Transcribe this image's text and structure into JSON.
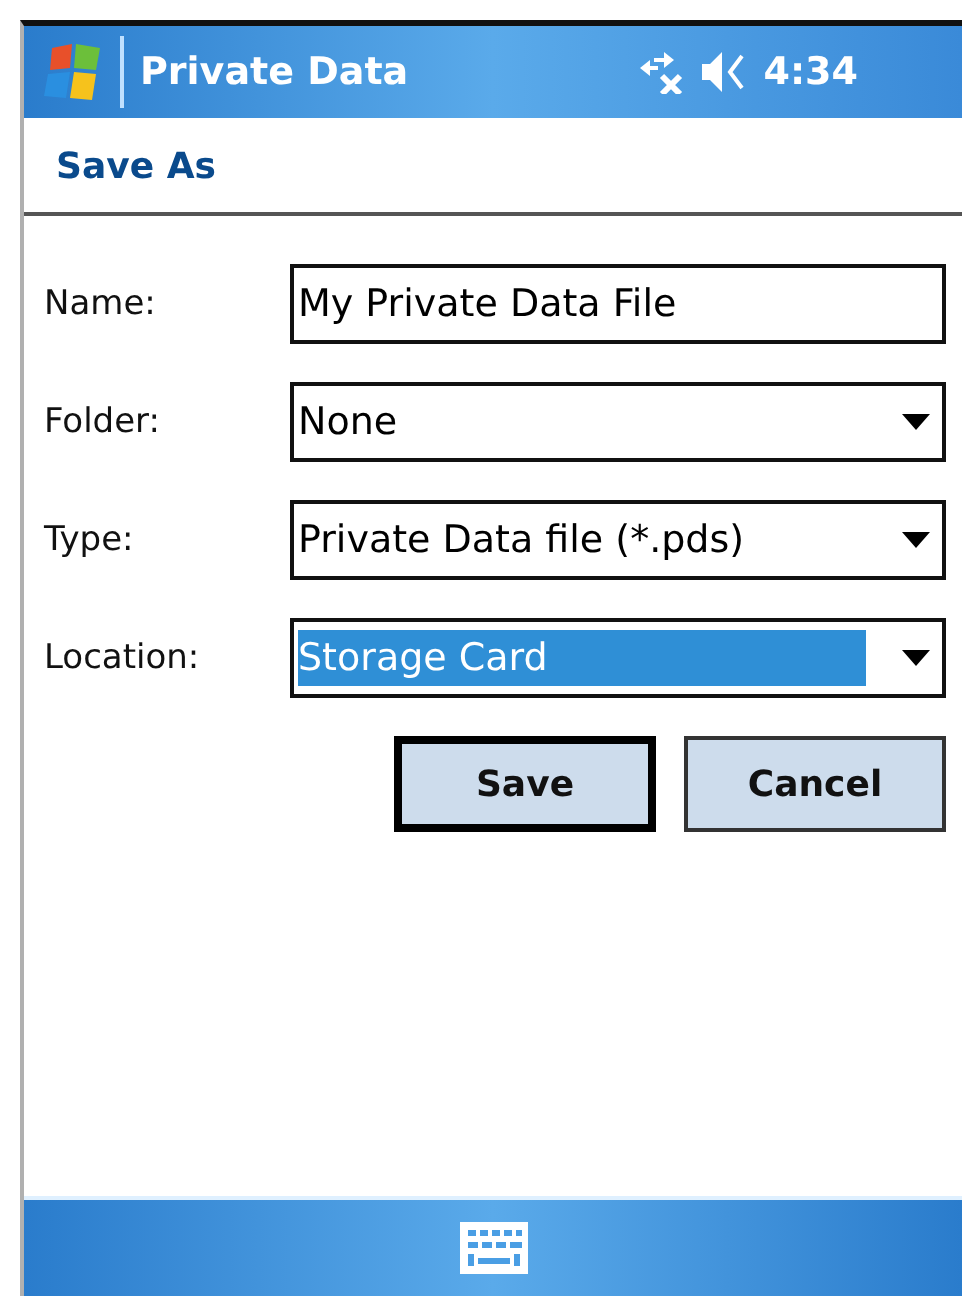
{
  "title_bar": {
    "title": "Private Data",
    "time": "4:34"
  },
  "header": "Save As",
  "fields": [
    {
      "label": "Name:",
      "kind": "text",
      "value": "My Private Data File",
      "selected": false
    },
    {
      "label": "Folder:",
      "kind": "dropdown",
      "value": "None",
      "selected": false
    },
    {
      "label": "Type:",
      "kind": "dropdown",
      "value": "Private Data file (*.pds)",
      "selected": false
    },
    {
      "label": "Location:",
      "kind": "dropdown",
      "value": "Storage Card",
      "selected": true
    }
  ],
  "buttons": [
    {
      "label": "Save",
      "default": true
    },
    {
      "label": "Cancel",
      "default": false
    }
  ]
}
